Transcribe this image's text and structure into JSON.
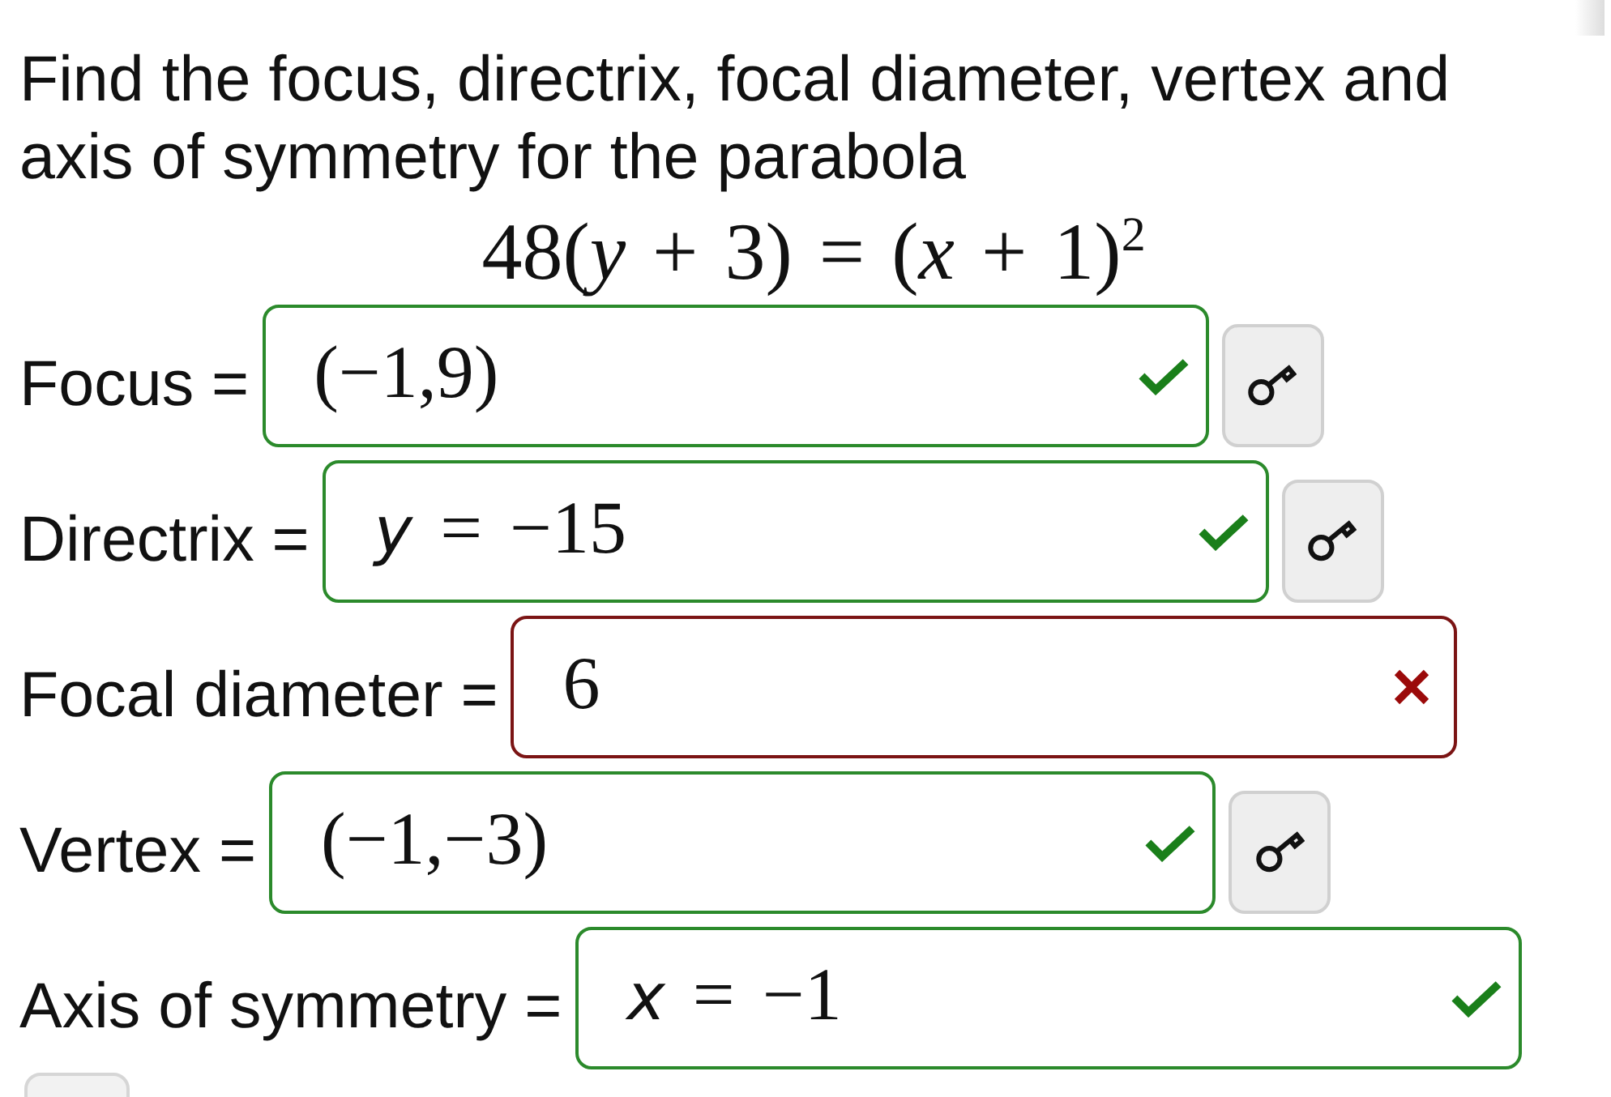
{
  "question": "Find the focus, directrix, focal diameter, vertex and axis of symmetry for the parabola",
  "equation": "48(*y* + 3) = (*x* + 1)$^{2}$",
  "answers": [
    {
      "label": "Focus =",
      "value": "(−1,9)",
      "correct": true,
      "key_button": true
    },
    {
      "label": "Directrix =",
      "value": "*y* = −15",
      "correct": true,
      "key_button": true
    },
    {
      "label": "Focal diameter =",
      "value": "6",
      "correct": false,
      "key_button": false
    },
    {
      "label": "Vertex =",
      "value": "(−1,−3)",
      "correct": true,
      "key_button": true
    },
    {
      "label": "Axis of symmetry =",
      "value": "*x* = −1",
      "correct": true,
      "key_button": false
    }
  ]
}
